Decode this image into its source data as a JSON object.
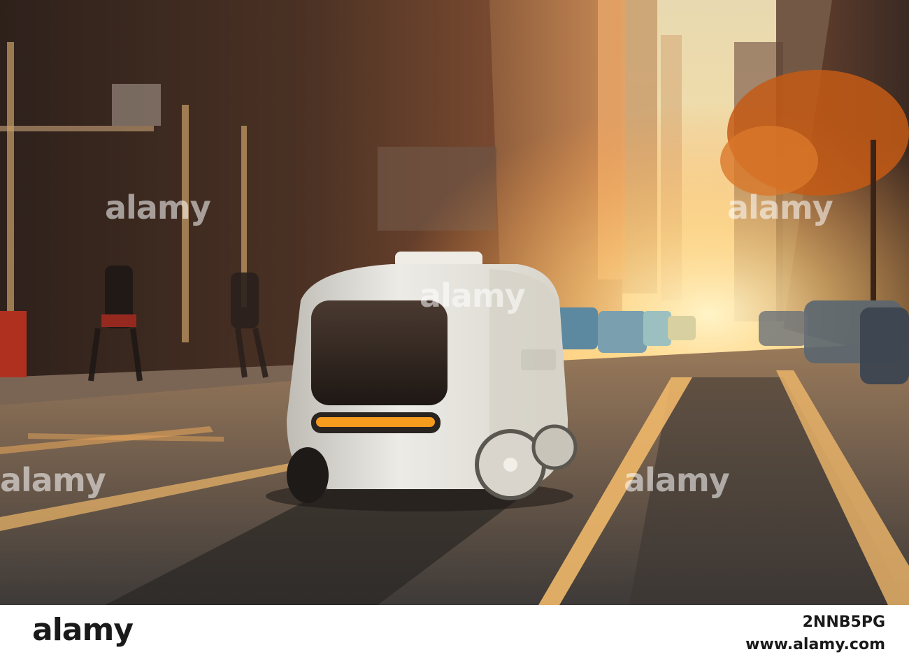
{
  "photo": {
    "description_icon": "street-scene",
    "colors": {
      "sky": "#f7e9b6",
      "sun_glow": "#ffd98a",
      "road": "#4a4642",
      "building_shadow": "#3a2a22",
      "lane_line": "#f0b86a",
      "robot_body": "#e4e2dc",
      "robot_light": "#f59b1e",
      "tree": "#c45a15"
    }
  },
  "watermarks": {
    "wm_a": "alamy",
    "wm_b": "alamy",
    "wm_c": "alamy",
    "wm_d": "alamy",
    "wm_e": "alamy"
  },
  "footer": {
    "brand": "alamy",
    "image_id": "2NNB5PG",
    "site": "www.alamy.com"
  }
}
